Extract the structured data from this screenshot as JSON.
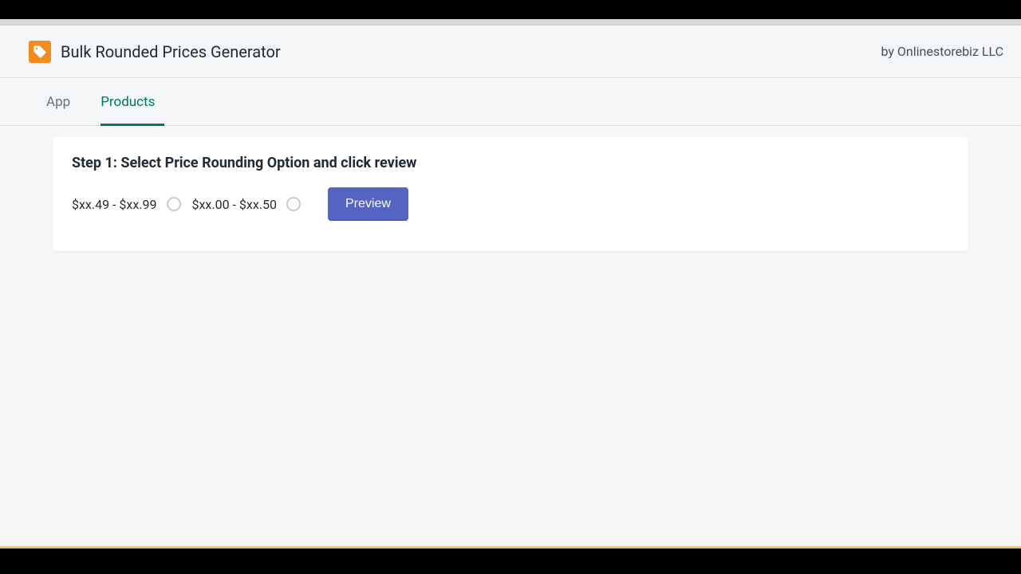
{
  "header": {
    "app_title": "Bulk Rounded Prices Generator",
    "vendor": "by Onlinestorebiz LLC"
  },
  "tabs": [
    {
      "label": "App",
      "active": false
    },
    {
      "label": "Products",
      "active": true
    }
  ],
  "card": {
    "step_title": "Step 1: Select Price Rounding Option and click review",
    "options": [
      {
        "label": "$xx.49 - $xx.99"
      },
      {
        "label": "$xx.00 - $xx.50"
      }
    ],
    "preview_label": "Preview"
  }
}
